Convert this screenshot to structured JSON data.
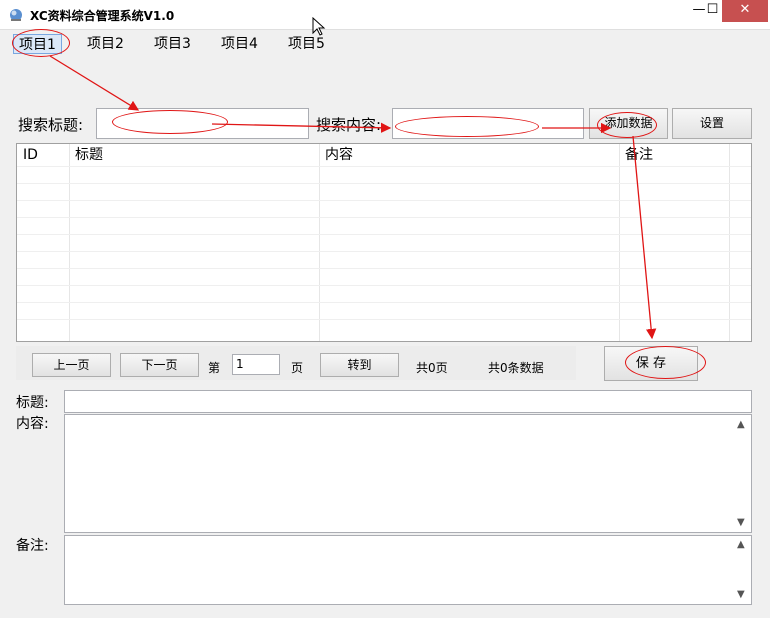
{
  "window": {
    "title": "XC资料综合管理系统V1.0",
    "minimize_glyph": "—",
    "maximize_glyph": "☐",
    "close_glyph": "✕"
  },
  "menu": {
    "items": [
      {
        "label": "项目1"
      },
      {
        "label": "项目2"
      },
      {
        "label": "项目3"
      },
      {
        "label": "项目4"
      },
      {
        "label": "项目5"
      }
    ]
  },
  "search": {
    "title_label": "搜索标题:",
    "title_value": "",
    "content_label": "搜索内容:",
    "content_value": "",
    "add_button": "添加数据",
    "settings_button": "设置"
  },
  "grid": {
    "columns": [
      "ID",
      "标题",
      "内容",
      "备注"
    ],
    "rows": []
  },
  "pager": {
    "prev": "上一页",
    "next": "下一页",
    "page_prefix": "第",
    "page_value": "1",
    "page_suffix": "页",
    "goto": "转到",
    "total_pages": "共0页",
    "total_records": "共0条数据",
    "save": "保 存"
  },
  "form": {
    "title_label": "标题:",
    "title_value": "",
    "content_label": "内容:",
    "content_value": "",
    "remark_label": "备注:",
    "remark_value": "",
    "scroll_up_glyph": "▲",
    "scroll_down_glyph": "▼"
  },
  "annotation_color": "#e01515"
}
